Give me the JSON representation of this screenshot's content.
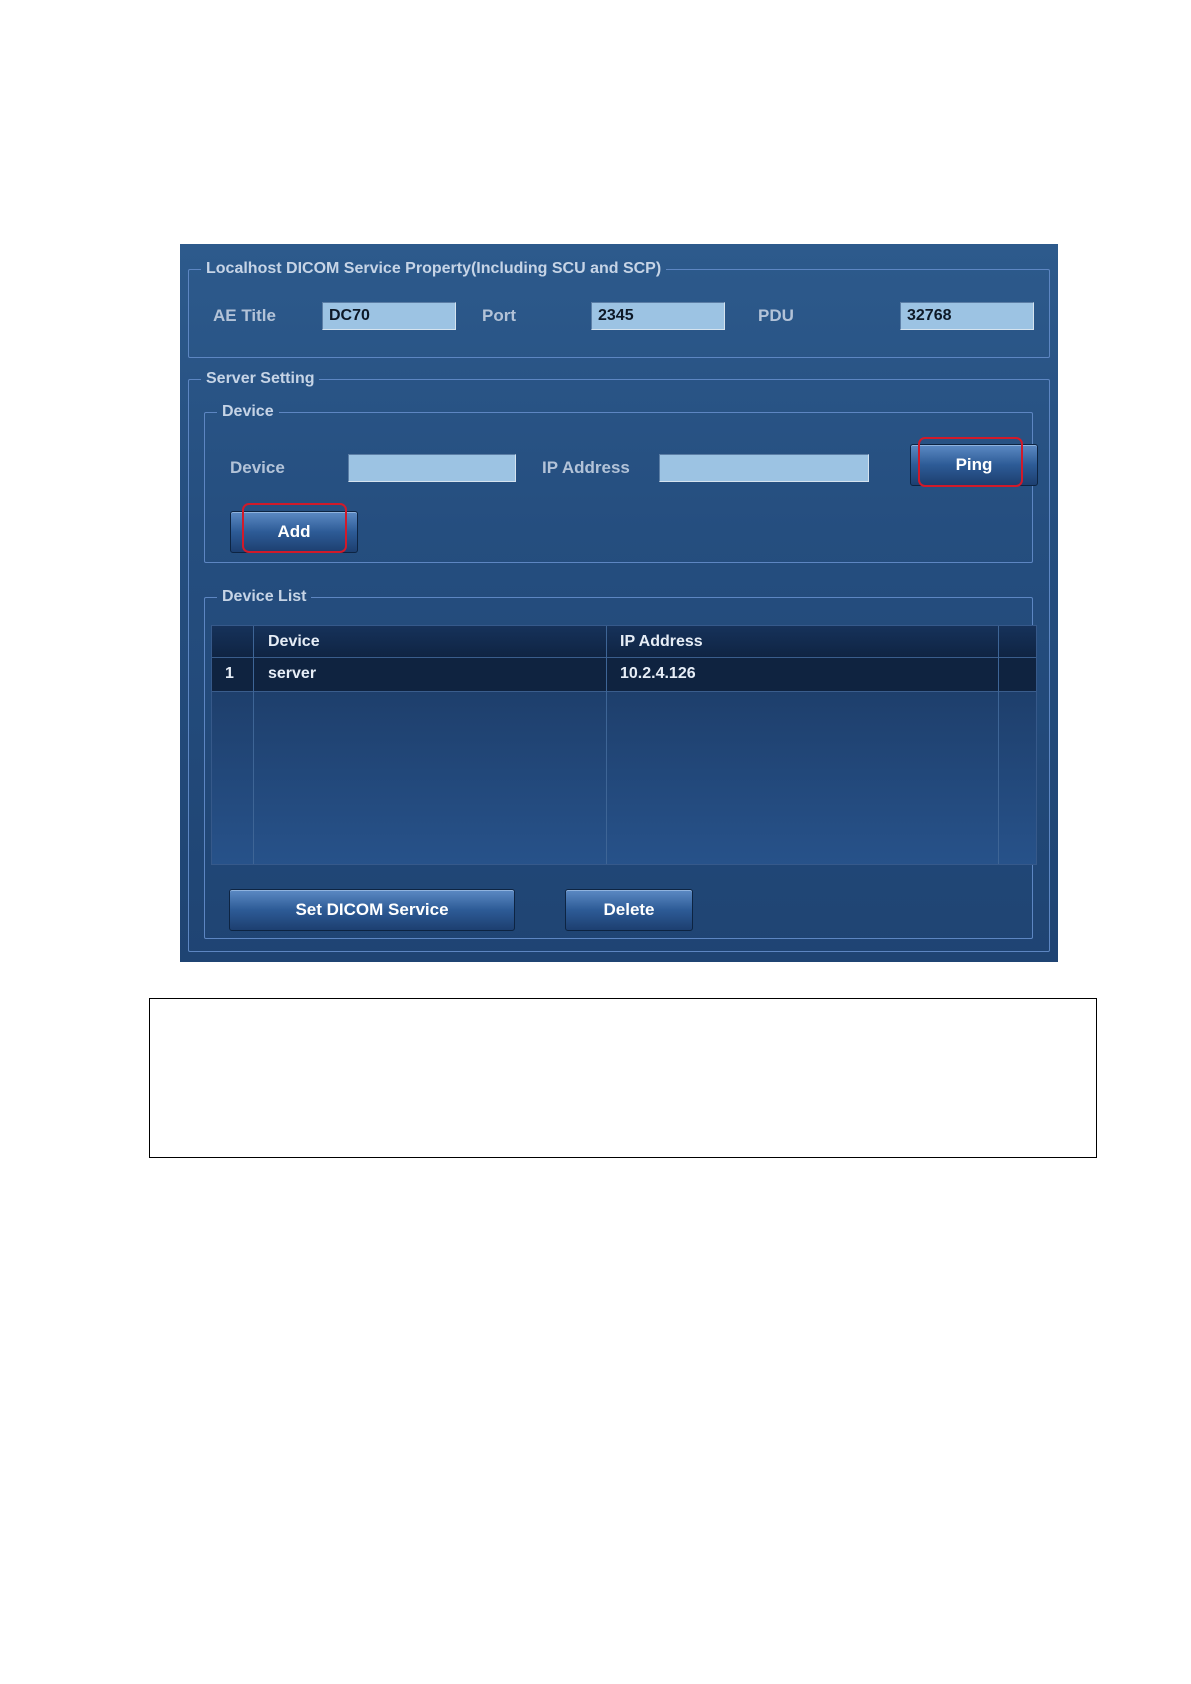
{
  "local": {
    "legend": "Localhost DICOM Service Property(Including SCU and SCP)",
    "ae_title_label": "AE Title",
    "ae_title_value": "DC70",
    "port_label": "Port",
    "port_value": "2345",
    "pdu_label": "PDU",
    "pdu_value": "32768"
  },
  "server": {
    "legend": "Server Setting",
    "device_group": {
      "legend": "Device",
      "device_label": "Device",
      "device_value": "",
      "ip_label": "IP Address",
      "ip_value": "",
      "ping_button": "Ping",
      "add_button": "Add"
    },
    "device_list": {
      "legend": "Device List",
      "columns": [
        "",
        "Device",
        "IP Address",
        ""
      ],
      "rows": [
        {
          "index": "1",
          "device": "server",
          "ip": "10.2.4.126"
        }
      ],
      "set_dicom_button": "Set DICOM Service",
      "delete_button": "Delete"
    }
  },
  "colors": {
    "panel": "#254e7f",
    "field": "#9cc3e3",
    "highlight": "#d11a2a"
  }
}
